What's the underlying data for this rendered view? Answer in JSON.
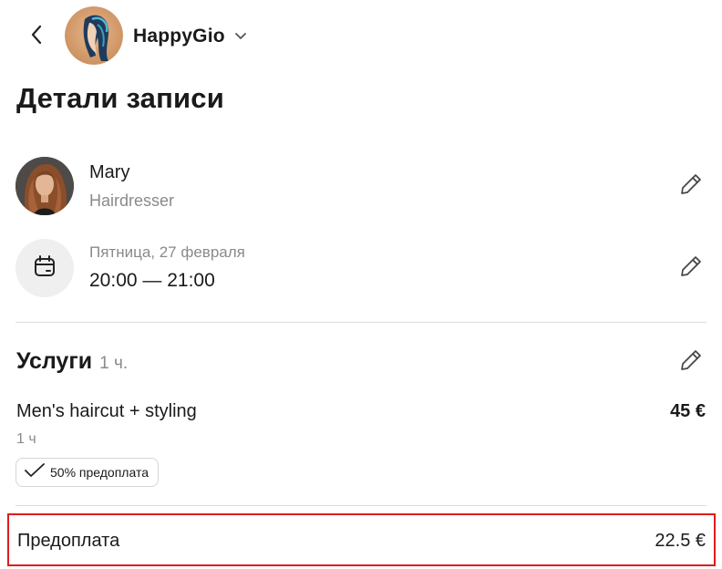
{
  "header": {
    "salon_name": "HappyGio"
  },
  "page": {
    "title": "Детали записи"
  },
  "master": {
    "name": "Mary",
    "role": "Hairdresser"
  },
  "appointment": {
    "date": "Пятница, 27 февраля",
    "time": "20:00 — 21:00"
  },
  "services": {
    "title": "Услуги",
    "total_duration": "1 ч.",
    "items": [
      {
        "name": "Men's haircut + styling",
        "price": "45 €",
        "duration": "1 ч",
        "prepayment_badge": "50% предоплата"
      }
    ]
  },
  "prepayment": {
    "label": "Предоплата",
    "amount": "22.5 €"
  },
  "colors": {
    "highlight_border": "#e11b1b",
    "muted_text": "#8a8a8a",
    "divider": "#dcdcdc"
  }
}
